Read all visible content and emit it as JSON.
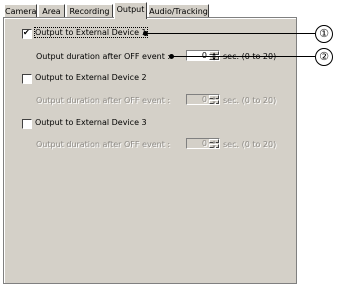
{
  "tabs": [
    {
      "label": "Camera",
      "active": false
    },
    {
      "label": "Area",
      "active": false
    },
    {
      "label": "Recording",
      "active": false
    },
    {
      "label": "Output",
      "active": true
    },
    {
      "label": "Audio/Tracking",
      "active": false
    }
  ],
  "devices": [
    {
      "label": "Output to External Device 1",
      "checked": true,
      "enabled": true,
      "duration_label": "Output duration after OFF event :",
      "duration_value": "0",
      "duration_range": "sec. (0 to 20)"
    },
    {
      "label": "Output to External Device 2",
      "checked": false,
      "enabled": false,
      "duration_label": "Output duration after OFF event :",
      "duration_value": "0",
      "duration_range": "sec. (0 to 20)"
    },
    {
      "label": "Output to External Device 3",
      "checked": false,
      "enabled": false,
      "duration_label": "Output duration after OFF event :",
      "duration_value": "0",
      "duration_range": "sec. (0 to 20)"
    }
  ],
  "callouts": [
    "①",
    "②"
  ],
  "colors": {
    "panel": "#d4d0c8",
    "disabled_text": "#8f8c87"
  }
}
